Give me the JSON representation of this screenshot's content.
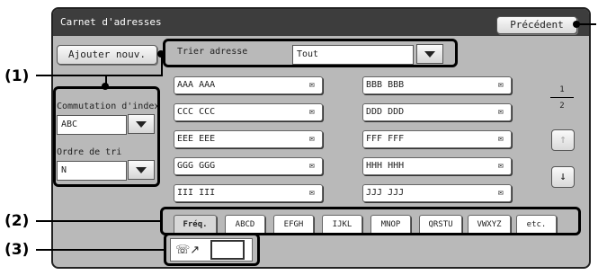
{
  "window": {
    "title": "Carnet d'adresses"
  },
  "toolbar": {
    "back_label": "Précédent",
    "add_label": "Ajouter nouv."
  },
  "sort": {
    "label": "Trier adresse",
    "value": "Tout"
  },
  "index_switch": {
    "label": "Commutation d'index",
    "value": "ABC"
  },
  "sort_order": {
    "label": "Ordre de tri",
    "value": "N"
  },
  "entries": [
    {
      "name": "AAA AAA",
      "icon": "envelope-icon"
    },
    {
      "name": "BBB BBB",
      "icon": "envelope-icon"
    },
    {
      "name": "CCC CCC",
      "icon": "envelope-icon"
    },
    {
      "name": "DDD DDD",
      "icon": "envelope-icon"
    },
    {
      "name": "EEE EEE",
      "icon": "envelope-icon"
    },
    {
      "name": "FFF FFF",
      "icon": "envelope-icon"
    },
    {
      "name": "GGG GGG",
      "icon": "envelope-icon"
    },
    {
      "name": "HHH HHH",
      "icon": "envelope-icon"
    },
    {
      "name": "III III",
      "icon": "envelope-icon"
    },
    {
      "name": "JJJ JJJ",
      "icon": "envelope-icon"
    }
  ],
  "pagination": {
    "current": "1",
    "total": "2"
  },
  "tabs": [
    {
      "label": "Fréq.",
      "active": true
    },
    {
      "label": "ABCD"
    },
    {
      "label": "EFGH"
    },
    {
      "label": "IJKL"
    },
    {
      "label": "MNOP"
    },
    {
      "label": "QRSTU"
    },
    {
      "label": "VWXYZ"
    },
    {
      "label": "etc."
    }
  ],
  "search_number": {
    "icon": "search-number-icon",
    "value": ""
  },
  "callouts": {
    "c1": "(1)",
    "c2": "(2)",
    "c3": "(3)"
  },
  "colors": {
    "titlebar": "#3d3d3d",
    "panel": "#b9b9b9",
    "highlight": "#000000"
  }
}
